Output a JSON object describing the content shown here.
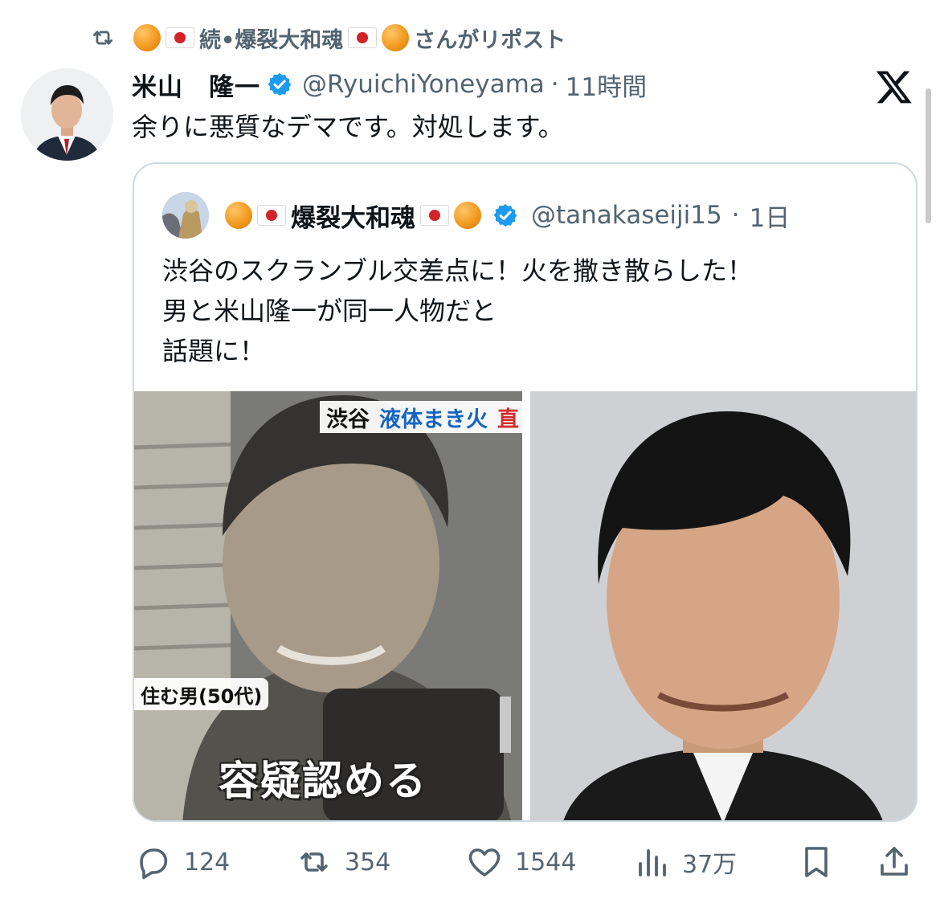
{
  "repost": {
    "reposter_name_prefix": "続•爆裂大和魂",
    "suffix": "さんがリポスト"
  },
  "tweet": {
    "author_name": "米山　隆一",
    "handle": "@RyuichiYoneyama",
    "separator": "·",
    "time": "11時間",
    "text": "余りに悪質なデマです。対処します。"
  },
  "quote": {
    "author_name": "爆裂大和魂",
    "handle": "@tanakaseiji15",
    "separator": "·",
    "time": "1日",
    "lines": [
      "渋谷のスクランブル交差点に！火を撒き散らした！",
      "男と米山隆一が同一人物だと",
      "話題に！"
    ],
    "media_left_captions": {
      "location": "渋谷",
      "topic": "液体まき火",
      "tag": "直",
      "person": "住む男(50代)",
      "headline": "容疑認める"
    }
  },
  "actions": {
    "replies": "124",
    "reposts": "354",
    "likes": "1544",
    "views": "37万"
  },
  "colors": {
    "text_primary": "#0f1419",
    "text_secondary": "#536471",
    "verified_blue": "#1d9bf0",
    "border": "#cfd9de"
  },
  "icons": {
    "repost": "repost-icon",
    "verified": "verified-badge-icon",
    "x_logo": "x-logo-icon",
    "reply": "reply-icon",
    "like": "heart-icon",
    "views": "views-chart-icon",
    "bookmark": "bookmark-icon",
    "share": "share-icon"
  }
}
